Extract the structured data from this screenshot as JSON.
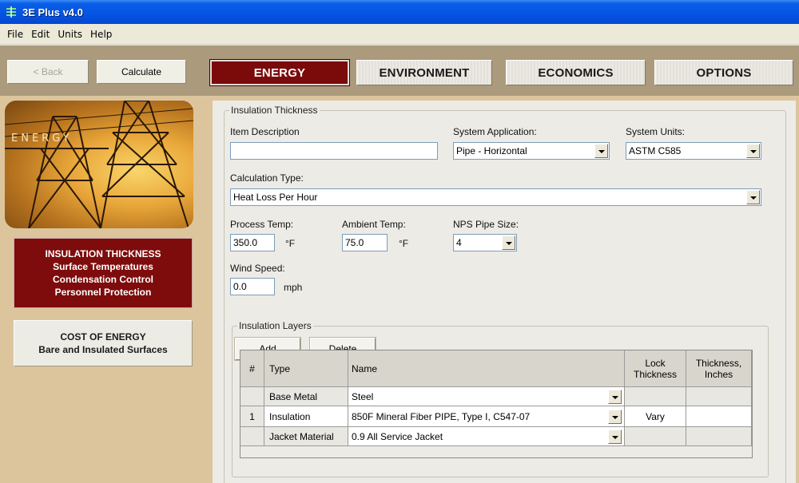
{
  "window": {
    "title": "3E Plus v4.0"
  },
  "menu": [
    "File",
    "Edit",
    "Units",
    "Help"
  ],
  "toolbar": {
    "back_label": "< Back",
    "calculate_label": "Calculate"
  },
  "tabs": [
    {
      "label": "ENERGY",
      "active": true
    },
    {
      "label": "ENVIRONMENT",
      "active": false
    },
    {
      "label": "ECONOMICS",
      "active": false
    },
    {
      "label": "OPTIONS",
      "active": false
    }
  ],
  "sidebar": {
    "image_text": "ENERGY",
    "active_panel": [
      "INSULATION THICKNESS",
      "Surface Temperatures",
      "Condensation Control",
      "Personnel Protection"
    ],
    "inactive_panel": [
      "COST OF ENERGY",
      "Bare and Insulated Surfaces"
    ],
    "accent_color": "#7e0c0c"
  },
  "form": {
    "group_title": "Insulation Thickness",
    "item_description": {
      "label": "Item Description",
      "value": ""
    },
    "system_application": {
      "label": "System Application:",
      "value": "Pipe - Horizontal"
    },
    "system_units": {
      "label": "System Units:",
      "value": "ASTM C585"
    },
    "calculation_type": {
      "label": "Calculation Type:",
      "value": "Heat Loss Per Hour"
    },
    "process_temp": {
      "label": "Process Temp:",
      "value": "350.0",
      "unit": "°F"
    },
    "ambient_temp": {
      "label": "Ambient Temp:",
      "value": "75.0",
      "unit": "°F"
    },
    "nps_pipe_size": {
      "label": "NPS Pipe Size:",
      "value": "4"
    },
    "wind_speed": {
      "label": "Wind Speed:",
      "value": "0.0",
      "unit": "mph"
    }
  },
  "layers": {
    "group_title": "Insulation Layers",
    "add_label": "Add",
    "delete_label": "Delete",
    "columns": [
      "#",
      "Type",
      "Name",
      "Lock\nThickness",
      "Thickness,\nInches"
    ],
    "rows": [
      {
        "num": "",
        "type": "Base Metal",
        "name": "Steel",
        "lock": "",
        "thickness": ""
      },
      {
        "num": "1",
        "type": "Insulation",
        "name": "850F Mineral Fiber PIPE, Type I, C547-07",
        "lock": "Vary",
        "thickness": ""
      },
      {
        "num": "",
        "type": "Jacket Material",
        "name": "0.9 All Service Jacket",
        "lock": "",
        "thickness": ""
      }
    ]
  }
}
